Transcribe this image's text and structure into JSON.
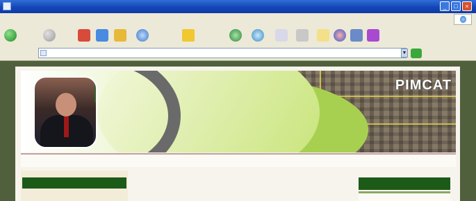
{
  "window": {
    "title": "",
    "controls": {
      "minimize": "_",
      "maximize": "□",
      "close": "×"
    }
  },
  "menubar": {
    "items": [
      "",
      "",
      "",
      "",
      "",
      ""
    ]
  },
  "toolbar": {
    "back_label": "",
    "search_label": "",
    "favorites_label": ""
  },
  "address": {
    "label": "",
    "url": "",
    "go_label": "",
    "links_label": ""
  },
  "page": {
    "banner": {
      "brand": "PIMCAT",
      "caption_line1": "",
      "caption_line2": "",
      "caption_small": ""
    },
    "nav": {
      "left_link": "",
      "date": ""
    },
    "left_panel": {
      "header": "",
      "subitem": ""
    },
    "right_panel": {
      "header": ""
    }
  },
  "icons": {
    "back": "back-arrow-icon",
    "forward": "forward-arrow-icon",
    "stop": "stop-icon",
    "refresh": "refresh-icon",
    "home": "home-icon",
    "search": "search-icon",
    "favorites": "favorites-star-icon",
    "media": "media-icon",
    "history": "history-icon",
    "mail": "mail-icon",
    "print": "print-icon",
    "edit": "edit-icon",
    "messenger": "messenger-icon"
  },
  "colors": {
    "titlebar": "#1446b8",
    "chrome": "#ece9d8",
    "banner_green": "#9fd04c",
    "panel_header": "#1c5a18"
  }
}
